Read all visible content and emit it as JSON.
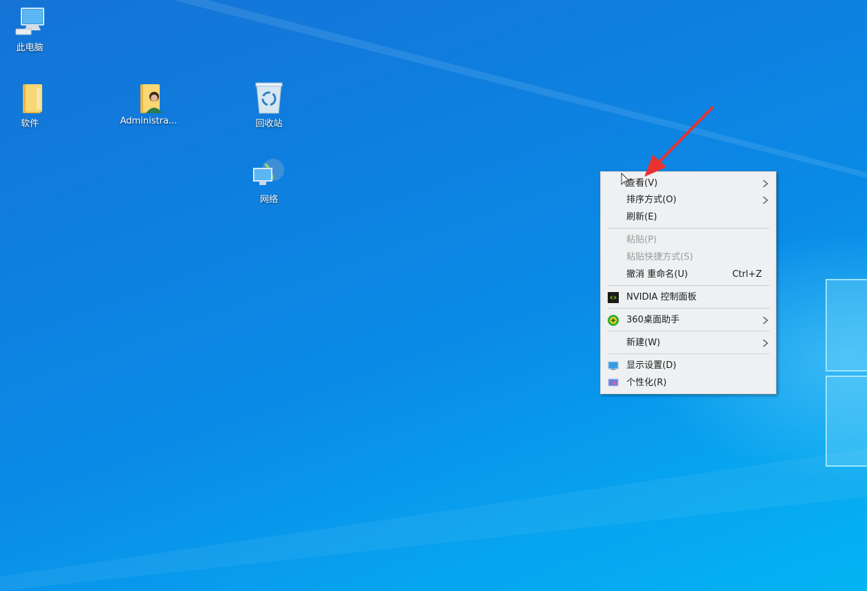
{
  "desktop": {
    "icons": [
      {
        "label": "此电脑",
        "icon": "this-pc-icon"
      },
      {
        "label": "软件",
        "icon": "folder-icon"
      },
      {
        "label": "Administra...",
        "icon": "user-folder-icon"
      },
      {
        "label": "回收站",
        "icon": "recycle-bin-icon"
      },
      {
        "label": "网络",
        "icon": "network-icon"
      }
    ]
  },
  "context_menu": {
    "items": [
      {
        "label": "查看(V)",
        "submenu": true
      },
      {
        "label": "排序方式(O)",
        "submenu": true
      },
      {
        "label": "刷新(E)"
      },
      {
        "label": "粘贴(P)",
        "disabled": true
      },
      {
        "label": "粘贴快捷方式(S)",
        "disabled": true
      },
      {
        "label": "撤消 重命名(U)",
        "shortcut": "Ctrl+Z"
      },
      {
        "label": "NVIDIA 控制面板",
        "icon": "nvidia-icon"
      },
      {
        "label": "360桌面助手",
        "icon": "360-icon",
        "submenu": true
      },
      {
        "label": "新建(W)",
        "submenu": true
      },
      {
        "label": "显示设置(D)",
        "icon": "display-settings-icon"
      },
      {
        "label": "个性化(R)",
        "icon": "personalize-icon"
      }
    ]
  },
  "colors": {
    "accent_arrow": "#e8322f",
    "menu_bg": "#eef0f2"
  }
}
